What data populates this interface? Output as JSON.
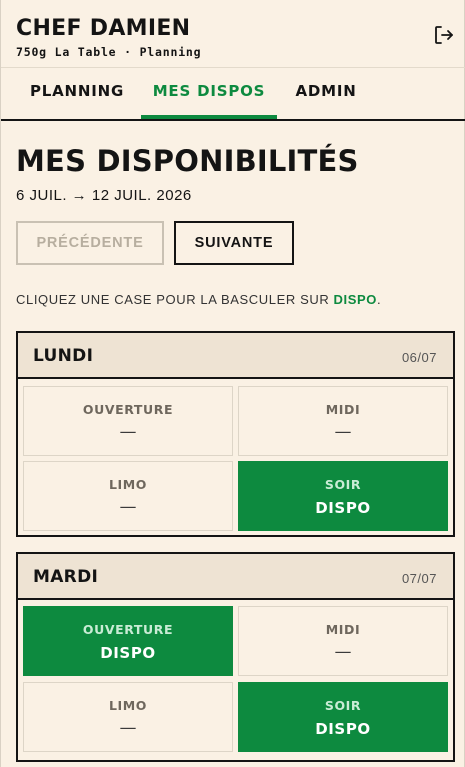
{
  "header": {
    "user_name": "CHEF DAMIEN",
    "subtitle": "750g La Table · Planning",
    "logout_icon": "logout-icon"
  },
  "tabs": [
    {
      "label": "PLANNING",
      "active": false
    },
    {
      "label": "MES DISPOS",
      "active": true
    },
    {
      "label": "ADMIN",
      "active": false
    }
  ],
  "page": {
    "title": "MES DISPONIBILITÉS",
    "date_range": "6 JUIL. → 12 JUIL. 2026",
    "prev_label": "PRÉCÉDENTE",
    "next_label": "SUIVANTE",
    "instruction_prefix": "CLIQUEZ UNE CASE POUR LA BASCULER SUR ",
    "instruction_highlight": "DISPO",
    "instruction_suffix": "."
  },
  "days": [
    {
      "name": "LUNDI",
      "date": "06/07",
      "slots": [
        {
          "label": "OUVERTURE",
          "value": "—",
          "dispo": false
        },
        {
          "label": "MIDI",
          "value": "—",
          "dispo": false
        },
        {
          "label": "LIMO",
          "value": "—",
          "dispo": false
        },
        {
          "label": "SOIR",
          "value": "DISPO",
          "dispo": true
        }
      ]
    },
    {
      "name": "MARDI",
      "date": "07/07",
      "slots": [
        {
          "label": "OUVERTURE",
          "value": "DISPO",
          "dispo": true
        },
        {
          "label": "MIDI",
          "value": "—",
          "dispo": false
        },
        {
          "label": "LIMO",
          "value": "—",
          "dispo": false
        },
        {
          "label": "SOIR",
          "value": "DISPO",
          "dispo": true
        }
      ]
    }
  ],
  "colors": {
    "accent": "#0d8a3f",
    "background": "#faf1e4",
    "header_band": "#eee3d3",
    "ink": "#141414"
  }
}
